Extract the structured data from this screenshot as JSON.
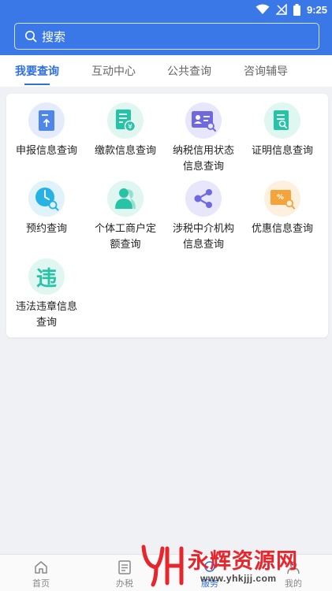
{
  "status_bar": {
    "time": "9:25"
  },
  "search": {
    "placeholder": "搜索"
  },
  "tabs": [
    {
      "label": "我要查询",
      "active": true
    },
    {
      "label": "互动中心",
      "active": false
    },
    {
      "label": "公共查询",
      "active": false
    },
    {
      "label": "咨询辅导",
      "active": false
    }
  ],
  "grid": [
    {
      "label": "申报信息查询",
      "icon": "declaration-upload-icon",
      "bg": "#e4ecfb",
      "color": "#4e86ec"
    },
    {
      "label": "缴款信息查询",
      "icon": "payment-document-icon",
      "bg": "#dff6f1",
      "color": "#26c3a7"
    },
    {
      "label": "纳税信用状态\n信息查询",
      "icon": "credit-id-card-icon",
      "bg": "#e7e6fa",
      "color": "#6e69df"
    },
    {
      "label": "证明信息查询",
      "icon": "certificate-search-icon",
      "bg": "#dff6f1",
      "color": "#26c3a7"
    },
    {
      "label": "预约查询",
      "icon": "clock-search-icon",
      "bg": "#e0f3fb",
      "color": "#27b2e6"
    },
    {
      "label": "个体工商户定\n额查询",
      "icon": "person-icon",
      "bg": "#dff6f1",
      "color": "#26c3a7"
    },
    {
      "label": "涉税中介机构\n信息查询",
      "icon": "share-network-icon",
      "bg": "#e7e6fa",
      "color": "#6e69df"
    },
    {
      "label": "优惠信息查询",
      "icon": "discount-coupon-icon",
      "bg": "#fdf0df",
      "color": "#f5a33b"
    },
    {
      "label": "违法违章信息\n查询",
      "icon": "violation-char-icon",
      "icon_text": "违",
      "bg": "#dff6f1",
      "color": "#26c3a7"
    }
  ],
  "bottom_nav": [
    {
      "label": "首页",
      "icon": "home-icon",
      "active": false
    },
    {
      "label": "办税",
      "icon": "document-list-icon",
      "active": false
    },
    {
      "label": "服务",
      "icon": "service-icon",
      "active": true
    },
    {
      "label": "我的",
      "icon": "profile-icon",
      "active": false
    }
  ],
  "watermark": {
    "brand": "永辉资源网",
    "url": "www.yhkjjj.com",
    "logo_text": "YH"
  },
  "colors": {
    "primary": "#3b78e7",
    "tab_active": "#2f6fe2",
    "background": "#f0f1f5"
  }
}
